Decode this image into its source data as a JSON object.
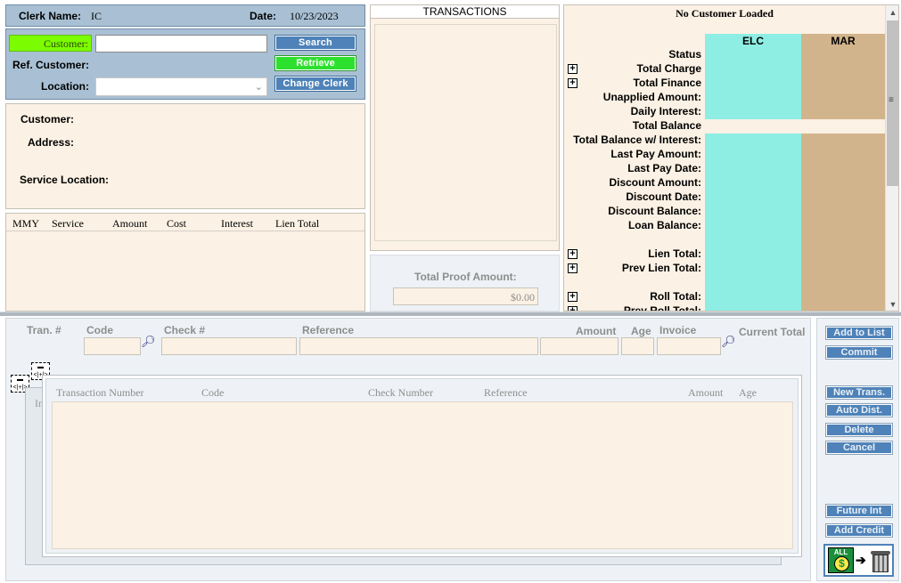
{
  "header": {
    "clerk_label": "Clerk Name:",
    "clerk_value": "IC",
    "date_label": "Date:",
    "date_value": "10/23/2023"
  },
  "search": {
    "customer_label": "Customer:",
    "ref_customer_label": "Ref. Customer:",
    "location_label": "Location:",
    "search_button": "Search",
    "retrieve_button": "Retrieve",
    "change_clerk_button": "Change Clerk",
    "customer_value": "",
    "location_value": ""
  },
  "customer_info": {
    "customer_label": "Customer:",
    "address_label": "Address:",
    "service_location_label": "Service Location:"
  },
  "service_table": {
    "columns": [
      "MMY",
      "Service",
      "Amount",
      "Cost",
      "Interest",
      "Lien Total"
    ]
  },
  "transactions": {
    "title": "TRANSACTIONS",
    "proof_label": "Total Proof Amount:",
    "proof_value": "$0.00"
  },
  "balances": {
    "title": "No Customer Loaded",
    "col_elc": "ELC",
    "col_mar": "MAR",
    "rows": [
      {
        "label": "Status",
        "expand": false
      },
      {
        "label": "Total Charge",
        "expand": true
      },
      {
        "label": "Total Finance",
        "expand": true
      },
      {
        "label": "Unapplied Amount:",
        "expand": false
      },
      {
        "label": "Daily Interest:",
        "expand": false
      },
      {
        "label": "Total Balance",
        "expand": false
      },
      {
        "label": "Total Balance w/ Interest:",
        "expand": false
      },
      {
        "label": "Last Pay Amount:",
        "expand": false
      },
      {
        "label": "Last Pay Date:",
        "expand": false
      },
      {
        "label": "Discount Amount:",
        "expand": false
      },
      {
        "label": "Discount Date:",
        "expand": false
      },
      {
        "label": "Discount Balance:",
        "expand": false
      },
      {
        "label": "Loan Balance:",
        "expand": false
      },
      {
        "label": "",
        "expand": false
      },
      {
        "label": "Lien Total:",
        "expand": true
      },
      {
        "label": "Prev Lien Total:",
        "expand": true
      },
      {
        "label": "",
        "expand": false
      },
      {
        "label": "Roll Total:",
        "expand": true
      },
      {
        "label": "Prev Roll Total:",
        "expand": true
      }
    ]
  },
  "entry": {
    "tran_label": "Tran. #",
    "code_label": "Code",
    "check_label": "Check #",
    "reference_label": "Reference",
    "amount_label": "Amount",
    "age_label": "Age",
    "invoice_label": "Invoice",
    "current_total_label": "Current Total"
  },
  "grid": {
    "columns": [
      "Transaction Number",
      "Code",
      "Check Number",
      "Reference",
      "Amount",
      "Age"
    ],
    "behind_label": "In"
  },
  "actions": {
    "add_to_list": "Add to List",
    "commit": "Commit",
    "new_trans": "New Trans.",
    "auto_dist": "Auto Dist.",
    "delete": "Delete",
    "cancel": "Cancel",
    "future_int": "Future Int",
    "add_credit": "Add Credit",
    "clear_all_label": "ALL"
  },
  "colors": {
    "elc_column": "#8eeee4",
    "mar_column": "#d2b48c",
    "panel_blue": "#a9c0d4",
    "button_blue": "#4e82b8",
    "retrieve_green": "#2ee02e",
    "customer_highlight": "#7cfc00",
    "cream": "#fbf1e4"
  }
}
